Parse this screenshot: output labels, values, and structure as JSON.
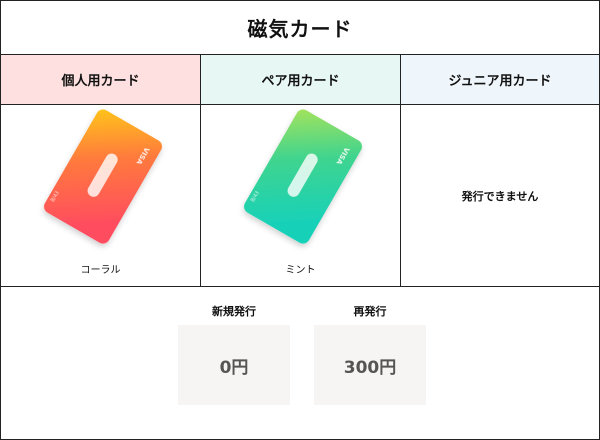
{
  "title": "磁気カード",
  "columns": [
    {
      "label": "個人用カード",
      "color": "#fde0df"
    },
    {
      "label": "ペア用カード",
      "color": "#e7f7f4"
    },
    {
      "label": "ジュニア用カード",
      "color": "#eef5fb"
    }
  ],
  "cards": [
    {
      "caption": "コーラル",
      "brand": "VISA",
      "gradient": [
        "#ffc61a",
        "#ff7a3d",
        "#ff4e5e"
      ],
      "icon": "coral-card-icon"
    },
    {
      "caption": "ミント",
      "brand": "VISA",
      "gradient": [
        "#a6e35a",
        "#3fd48f",
        "#18d1b8"
      ],
      "icon": "mint-card-icon"
    }
  ],
  "junior_note": "発行できません",
  "fees": {
    "new_issue_label": "新規発行",
    "new_issue_value": "0円",
    "reissue_label": "再発行",
    "reissue_value": "300円"
  }
}
